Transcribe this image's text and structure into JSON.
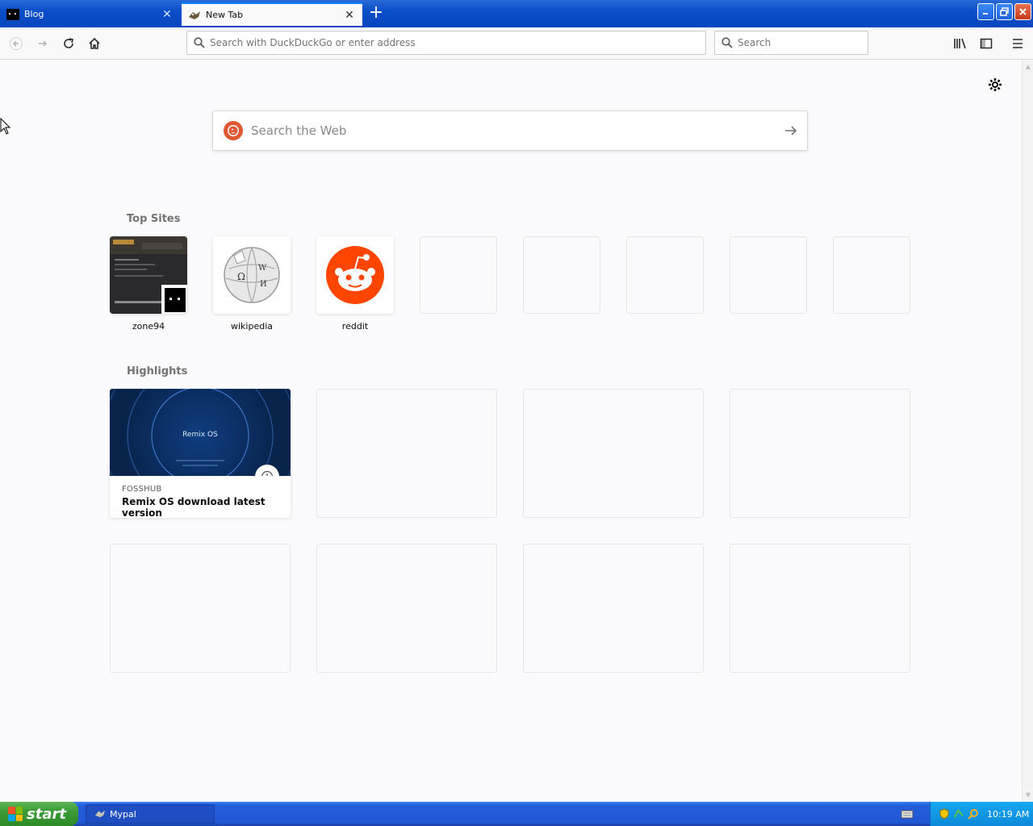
{
  "tabs": [
    {
      "label": "Blog",
      "active": false
    },
    {
      "label": "New Tab",
      "active": true
    }
  ],
  "navbar": {
    "url_placeholder": "Search with DuckDuckGo or enter address",
    "search_placeholder": "Search"
  },
  "page": {
    "websearch_placeholder": "Search the Web",
    "top_sites_title": "Top Sites",
    "top_sites": [
      {
        "name": "zone94"
      },
      {
        "name": "wikipedia"
      },
      {
        "name": "reddit"
      }
    ],
    "highlights_title": "Highlights",
    "highlights": [
      {
        "source": "FOSSHUB",
        "title": "Remix OS download latest version",
        "thumb_text": "Remix OS"
      }
    ]
  },
  "taskbar": {
    "start_label": "start",
    "task_label": "Mypal",
    "clock": "10:19 AM"
  },
  "colors": {
    "xp_blue": "#0a4ec8",
    "accent": "#0a84ff",
    "reddit": "#ff4500",
    "duckduckgo": "#de5833"
  }
}
